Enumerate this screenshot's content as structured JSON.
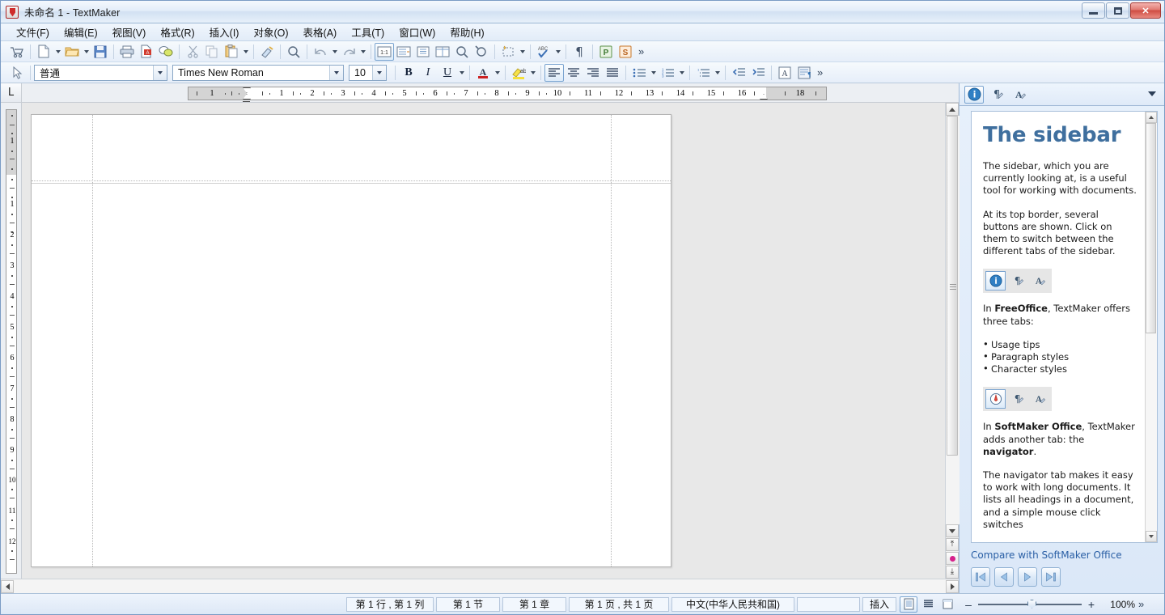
{
  "window": {
    "title": "未命名 1 - TextMaker",
    "app_icon": "textmaker-icon",
    "minimize_label": "",
    "maximize_label": "",
    "close_label": "✕"
  },
  "menubar": {
    "items": [
      {
        "label": "文件(F)",
        "name": "menu-file"
      },
      {
        "label": "编辑(E)",
        "name": "menu-edit"
      },
      {
        "label": "视图(V)",
        "name": "menu-view"
      },
      {
        "label": "格式(R)",
        "name": "menu-format"
      },
      {
        "label": "插入(I)",
        "name": "menu-insert"
      },
      {
        "label": "对象(O)",
        "name": "menu-object"
      },
      {
        "label": "表格(A)",
        "name": "menu-table"
      },
      {
        "label": "工具(T)",
        "name": "menu-tools"
      },
      {
        "label": "窗口(W)",
        "name": "menu-window"
      },
      {
        "label": "帮助(H)",
        "name": "menu-help"
      }
    ]
  },
  "toolbar": {
    "overflow_label": "»",
    "buttons": [
      {
        "name": "shop-cart-icon"
      },
      {
        "name": "new-document-icon"
      },
      {
        "name": "open-folder-icon"
      },
      {
        "name": "save-icon"
      },
      {
        "name": "print-icon"
      },
      {
        "name": "export-pdf-icon"
      },
      {
        "name": "send-email-icon"
      },
      {
        "name": "cut-icon"
      },
      {
        "name": "copy-icon"
      },
      {
        "name": "paste-icon"
      },
      {
        "name": "format-painter-icon"
      },
      {
        "name": "search-icon"
      },
      {
        "name": "undo-icon"
      },
      {
        "name": "redo-icon"
      },
      {
        "name": "zoom-100-icon"
      },
      {
        "name": "page-width-icon"
      },
      {
        "name": "whole-page-icon"
      },
      {
        "name": "multi-page-icon"
      },
      {
        "name": "zoom-in-icon"
      },
      {
        "name": "zoom-out-icon"
      },
      {
        "name": "insert-frame-icon"
      },
      {
        "name": "spellcheck-icon"
      },
      {
        "name": "formatting-marks-icon"
      },
      {
        "name": "presentations-icon"
      },
      {
        "name": "planmaker-icon"
      }
    ]
  },
  "formatbar": {
    "paragraph_style": "普通",
    "font_name": "Times New Roman",
    "font_size": "10",
    "bold_label": "B",
    "italic_label": "I",
    "underline_label": "U",
    "overflow_label": "»",
    "buttons": [
      {
        "name": "font-color-icon"
      },
      {
        "name": "highlight-color-icon"
      },
      {
        "name": "align-left-icon"
      },
      {
        "name": "align-center-icon"
      },
      {
        "name": "align-right-icon"
      },
      {
        "name": "align-justify-icon"
      },
      {
        "name": "bullet-list-icon"
      },
      {
        "name": "numbered-list-icon"
      },
      {
        "name": "outline-list-icon"
      },
      {
        "name": "decrease-indent-icon"
      },
      {
        "name": "increase-indent-icon"
      },
      {
        "name": "character-format-icon"
      },
      {
        "name": "paragraph-format-icon"
      }
    ]
  },
  "ruler": {
    "tab_selector_label": "L",
    "horizontal_labels": [
      "1",
      "1",
      "2",
      "3",
      "4",
      "5",
      "6",
      "7",
      "8",
      "9",
      "10",
      "11",
      "12",
      "13",
      "14",
      "15",
      "16",
      "18"
    ],
    "vertical_labels": [
      "1",
      "1",
      "2",
      "3",
      "4",
      "5",
      "6",
      "7",
      "8",
      "9",
      "10",
      "11",
      "12"
    ]
  },
  "document": {
    "page_background": "#ffffff",
    "canvas_background": "#e8e8e8"
  },
  "sidebar": {
    "tabs": [
      {
        "name": "sidebar-tab-usage-tips",
        "icon": "info-icon",
        "selected": true
      },
      {
        "name": "sidebar-tab-paragraph-styles",
        "icon": "paragraph-style-icon",
        "selected": false
      },
      {
        "name": "sidebar-tab-character-styles",
        "icon": "character-style-icon",
        "selected": false
      }
    ],
    "menu_icon": "chevron-down-icon",
    "heading": "The sidebar",
    "paragraph1": "The sidebar, which you are currently looking at, is a useful tool for working with documents.",
    "paragraph2": "At its top border, several buttons are shown. Click on them to switch between the different tabs of the sidebar.",
    "icon_row_1": [
      {
        "name": "info-icon",
        "selected": true
      },
      {
        "name": "paragraph-style-icon",
        "selected": false
      },
      {
        "name": "character-style-icon",
        "selected": false
      }
    ],
    "paragraph3_prefix": "In ",
    "paragraph3_bold": "FreeOffice",
    "paragraph3_suffix": ", TextMaker offers three tabs:",
    "bullets": [
      "Usage tips",
      "Paragraph styles",
      "Character styles"
    ],
    "icon_row_2": [
      {
        "name": "navigator-icon",
        "selected": true
      },
      {
        "name": "paragraph-style-icon",
        "selected": false
      },
      {
        "name": "character-style-icon",
        "selected": false
      }
    ],
    "paragraph4_prefix": "In ",
    "paragraph4_bold1": "SoftMaker Office",
    "paragraph4_mid": ", TextMaker adds another tab: the ",
    "paragraph4_bold2": "navigator",
    "paragraph4_suffix": ".",
    "paragraph5": "The navigator tab makes it easy to work with long documents. It lists all headings in a document, and a simple mouse click switches",
    "link": "Compare with SoftMaker Office",
    "nav_buttons": [
      {
        "name": "first-page-button",
        "icon": "skip-back-icon"
      },
      {
        "name": "previous-page-button",
        "icon": "play-back-icon"
      },
      {
        "name": "next-page-button",
        "icon": "play-forward-icon"
      },
      {
        "name": "last-page-button",
        "icon": "skip-forward-icon"
      }
    ]
  },
  "statusbar": {
    "cells": [
      {
        "name": "status-line-column",
        "label": "第 1 行 , 第 1 列"
      },
      {
        "name": "status-section",
        "label": "第 1 节"
      },
      {
        "name": "status-chapter",
        "label": "第 1 章"
      },
      {
        "name": "status-page",
        "label": "第 1 页 , 共 1 页"
      },
      {
        "name": "status-language",
        "label": "中文(中华人民共和国)"
      },
      {
        "name": "status-empty",
        "label": ""
      }
    ],
    "insert_mode": "插入",
    "view_buttons": [
      {
        "name": "view-normal-button",
        "icon": "page-view-icon",
        "selected": true
      },
      {
        "name": "view-draft-button",
        "icon": "draft-view-icon",
        "selected": false
      },
      {
        "name": "view-outline-button",
        "icon": "outline-view-icon",
        "selected": false
      }
    ],
    "zoom_minus": "–",
    "zoom_plus": "+",
    "zoom_value": "100%",
    "overflow_label": "»"
  },
  "colors": {
    "accent_blue": "#3f6f9e",
    "link_blue": "#2a5fa5",
    "window_frame": "#7a9bc4",
    "close_red": "#cf4c42",
    "browse_dot": "#d6218c"
  }
}
